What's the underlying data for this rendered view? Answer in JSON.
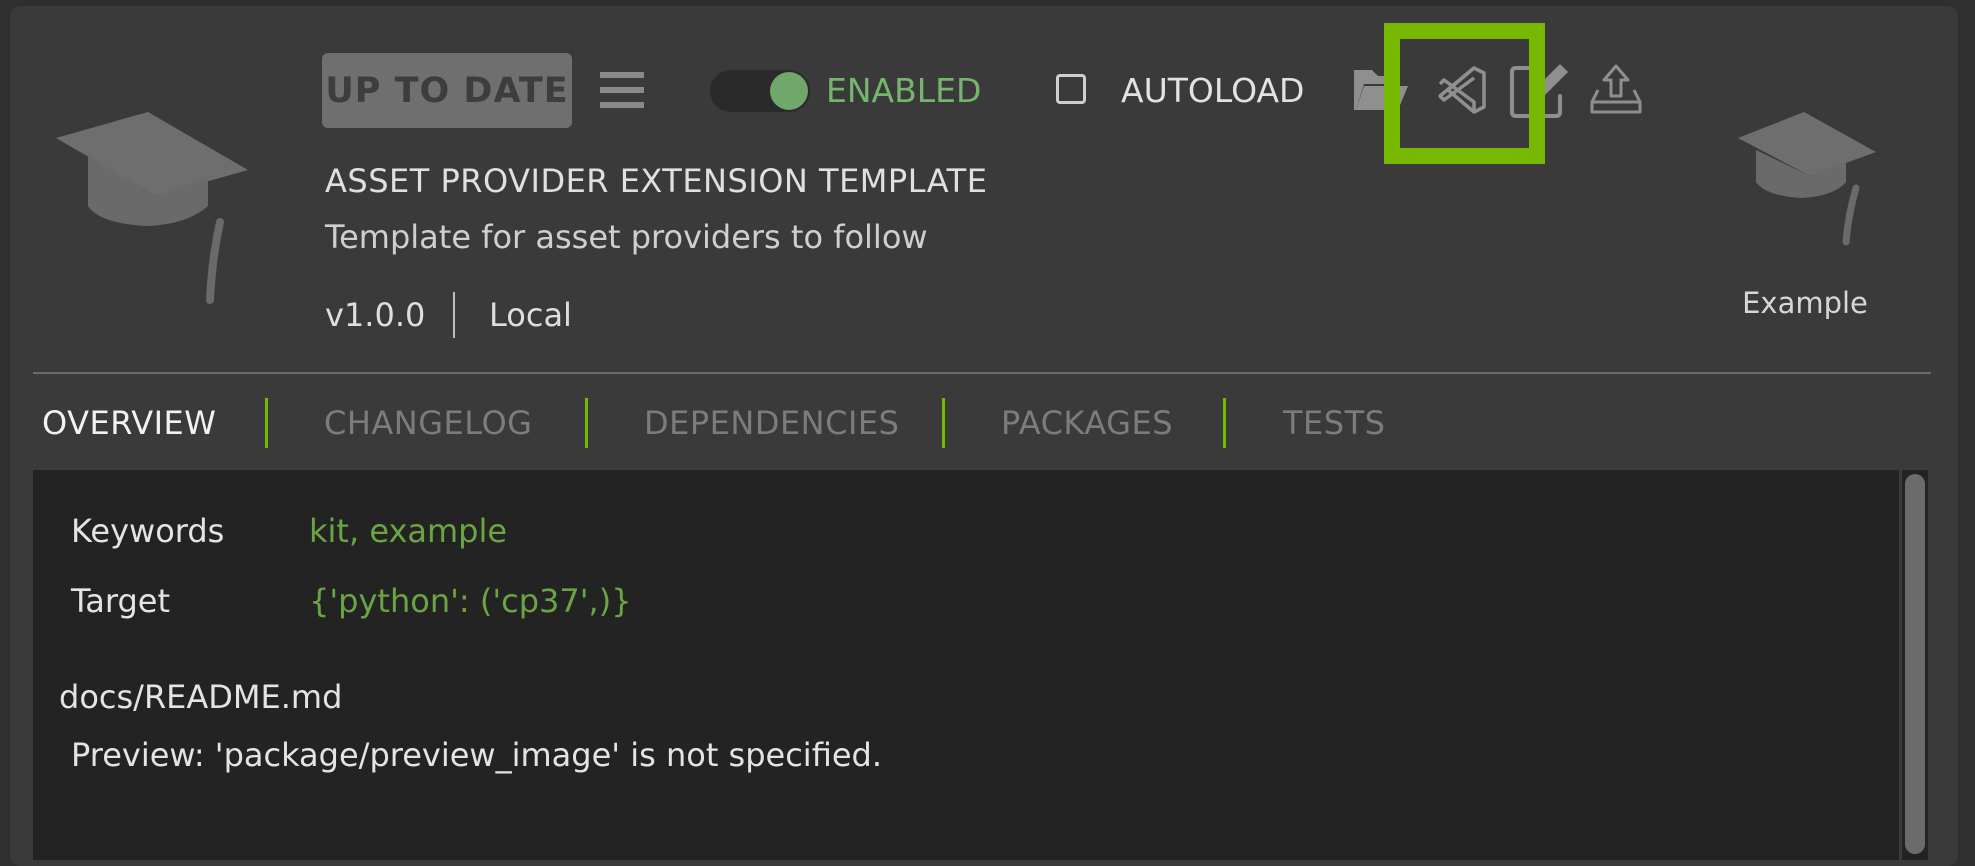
{
  "header": {
    "status_badge": "UP TO DATE",
    "toggle": {
      "label": "ENABLED",
      "on": true
    },
    "autoload": {
      "label": "AUTOLOAD",
      "checked": false
    },
    "title": "ASSET PROVIDER EXTENSION TEMPLATE",
    "description": "Template for asset providers to follow",
    "version": "v1.0.0",
    "source": "Local",
    "preview_label": "Example",
    "icons": [
      "menu-icon",
      "folder-open-icon",
      "vscode-icon",
      "edit-icon",
      "publish-icon",
      "graduation-cap-icon"
    ]
  },
  "tabs": [
    {
      "label": "OVERVIEW",
      "active": true
    },
    {
      "label": "CHANGELOG",
      "active": false
    },
    {
      "label": "DEPENDENCIES",
      "active": false
    },
    {
      "label": "PACKAGES",
      "active": false
    },
    {
      "label": "TESTS",
      "active": false
    }
  ],
  "overview": {
    "keywords_label": "Keywords",
    "keywords_value": "kit, example",
    "target_label": "Target",
    "target_value": "{'python': ('cp37',)}",
    "readme_path": "docs/README.md",
    "preview_message": "Preview: 'package/preview_image' is not specified."
  },
  "colors": {
    "accent": "#77b900",
    "enabled_green": "#76b56d",
    "value_green": "#6aa443",
    "panel_bg": "#3a3a3a",
    "content_bg": "#232324"
  }
}
